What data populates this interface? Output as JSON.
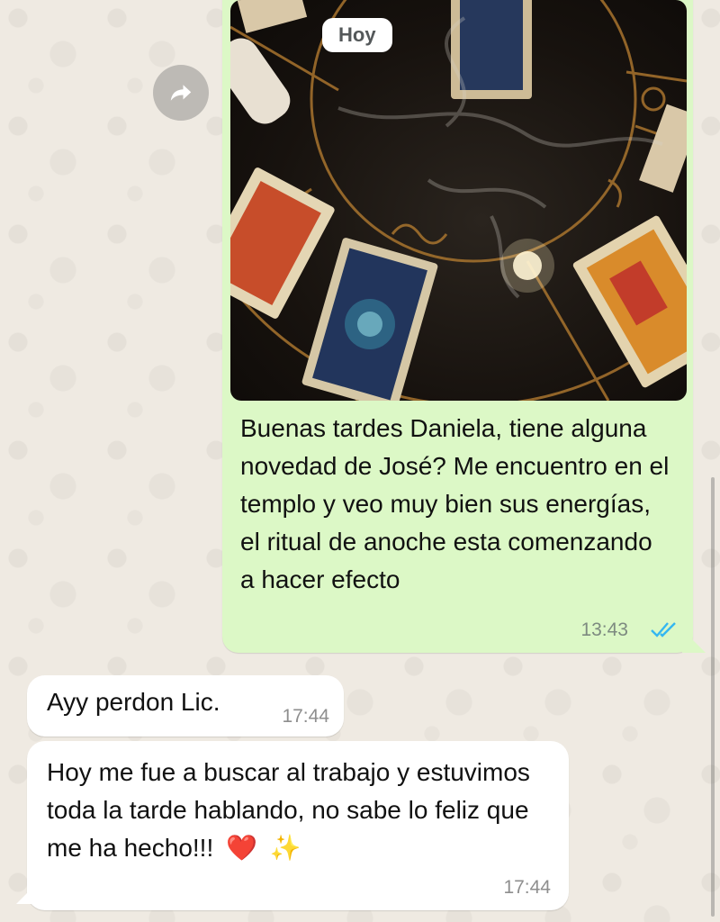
{
  "date_badge": "Hoy",
  "outgoing": {
    "text": "Buenas tardes Daniela, tiene alguna novedad de José? Me encuentro en el templo y veo muy bien sus energías, el ritual de anoche esta comenzando a hacer efecto",
    "time": "13:43",
    "status_icon": "double-check-read-icon",
    "tick_color": "#34b7f1"
  },
  "incoming": [
    {
      "text": "Ayy perdon Lic.",
      "time": "17:44"
    },
    {
      "text": "Hoy me fue a buscar al trabajo y estuvimos toda la tarde hablando, no sabe lo feliz que me ha hecho!!!",
      "emojis": [
        "❤️",
        "✨"
      ],
      "time": "17:44"
    }
  ],
  "colors": {
    "outgoing_bubble": "#dcf8c6",
    "incoming_bubble": "#ffffff",
    "wallpaper": "#efeae2"
  }
}
